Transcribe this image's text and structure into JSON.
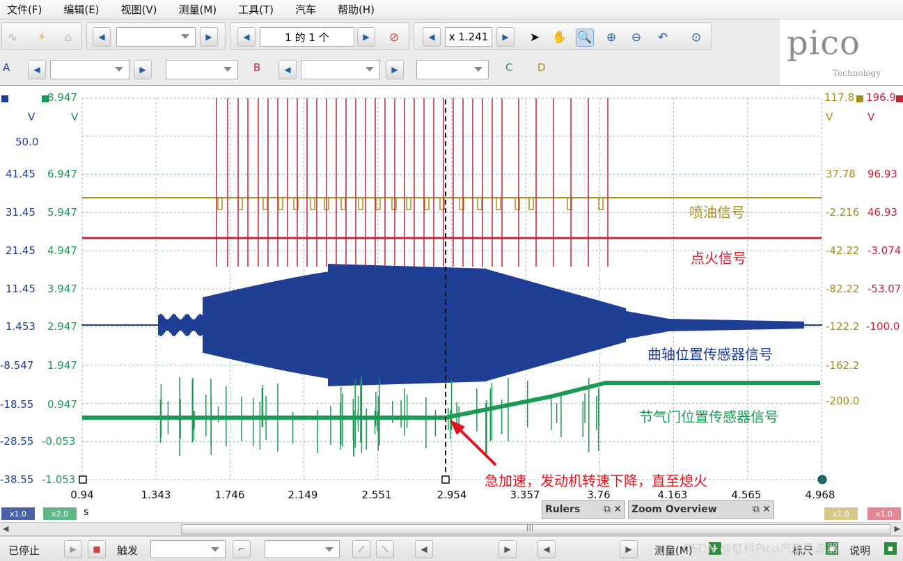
{
  "menu": [
    "文件(F)",
    "编辑(E)",
    "视图(V)",
    "测量(M)",
    "工具(T)",
    "汽车",
    "帮助(H)"
  ],
  "toolbar": {
    "buffer_label": "1 的 1 个",
    "zoom_label": "x 1.241"
  },
  "channels": {
    "a": "A",
    "b": "B",
    "c": "C",
    "d": "D"
  },
  "logo": {
    "word": "pico",
    "sub": "Technology"
  },
  "axes": {
    "a_unit": "V",
    "b_unit": "V",
    "c_unit": "V",
    "d_unit": "V",
    "a_ticks": [
      "50.0",
      "41.45",
      "31.45",
      "21.45",
      "11.45",
      "1.453",
      "-8.547",
      "-18.55",
      "-28.55",
      "-38.55"
    ],
    "b_ticks": [
      "8.947",
      "6.947",
      "5.947",
      "4.947",
      "3.947",
      "2.947",
      "1.947",
      "0.947",
      "-0.053",
      "-1.053"
    ],
    "c_ticks": [
      "117.8",
      "37.78",
      "-2.216",
      "-42.22",
      "-82.22",
      "-122.2",
      "-162.2",
      "-200.0"
    ],
    "d_ticks": [
      "196.9",
      "96.93",
      "46.93",
      "-3.074",
      "-53.07",
      "-100.0"
    ],
    "x_ticks": [
      "0.94",
      "1.343",
      "1.746",
      "2.149",
      "2.551",
      "2.954",
      "3.357",
      "3.76",
      "4.163",
      "4.565",
      "4.968"
    ],
    "x_unit": "s"
  },
  "annotations": {
    "injector": "喷油信号",
    "ignition": "点火信号",
    "crank": "曲轴位置传感器信号",
    "throttle": "节气门位置传感器信号",
    "note": "急加速，发动机转速下降，直至熄火"
  },
  "colors": {
    "a": "#1f3f95",
    "b": "#1a9a55",
    "c": "#a88c1e",
    "d": "#c4243a"
  },
  "scale": {
    "a": "x1.0",
    "b": "x2.0",
    "c": "x1.0",
    "d": "x1.0"
  },
  "panels": {
    "rulers": "Rulers",
    "zoom": "Zoom Overview"
  },
  "status": {
    "state": "已停止",
    "trigger": "触发",
    "measure": "测量(M)",
    "ruler": "标尺",
    "notes": "说明"
  },
  "watermark": "CSDN @虹科Pico汽车示波器"
}
